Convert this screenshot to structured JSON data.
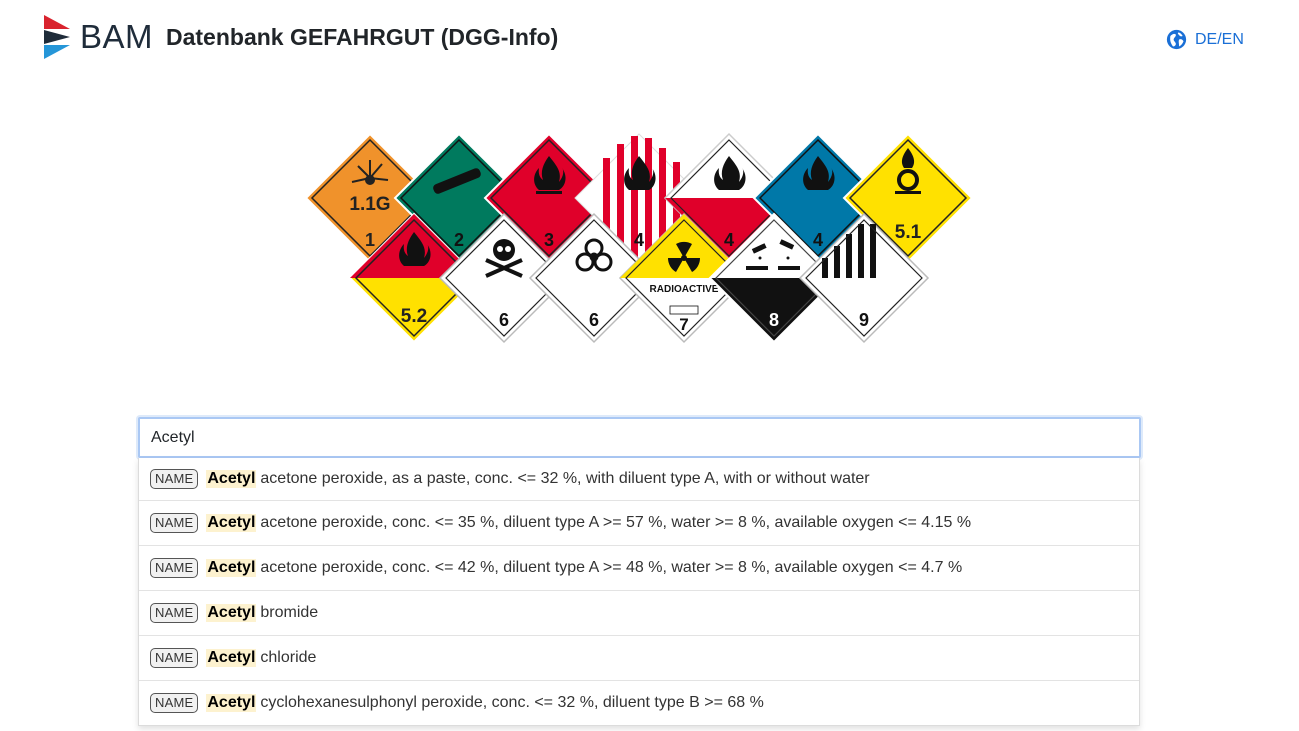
{
  "header": {
    "logo_text": "BAM",
    "title": "Datenbank GEFAHRGUT (DGG-Info)",
    "language_label": "DE/EN"
  },
  "hazard_labels": [
    {
      "text": "1.1G",
      "number": "1",
      "icon": "explosive-icon",
      "color": "#f0922b"
    },
    {
      "number": "2",
      "icon": "gas-cylinder-icon",
      "color": "#007a5e"
    },
    {
      "number": "3",
      "icon": "flame-icon",
      "color": "#e0002a"
    },
    {
      "number": "4",
      "icon": "flame-icon",
      "color": "#e0002a"
    },
    {
      "number": "4",
      "icon": "flame-icon",
      "color": "#e0002a"
    },
    {
      "number": "4",
      "icon": "flame-icon",
      "color": "#0078a8"
    },
    {
      "text": "5.1",
      "icon": "oxidizer-icon",
      "color": "#ffe100"
    },
    {
      "text": "5.2",
      "icon": "flame-icon",
      "color": "#e0002a"
    },
    {
      "number": "6",
      "icon": "skull-icon",
      "color": "#ffffff"
    },
    {
      "number": "6",
      "icon": "biohazard-icon",
      "color": "#ffffff"
    },
    {
      "text": "RADIOACTIVE",
      "number": "7",
      "icon": "radiation-icon",
      "color": "#ffe100"
    },
    {
      "number": "8",
      "icon": "corrosive-icon",
      "color": "#000000"
    },
    {
      "number": "9",
      "icon": "stripes-icon",
      "color": "#ffffff"
    }
  ],
  "search": {
    "value": "Acetyl",
    "highlight_color": "#fdf2cf",
    "focus_color": "#aac8f4"
  },
  "suggestions": [
    {
      "badge": "NAME",
      "match": "Acetyl",
      "rest": "acetone peroxide, as a paste, conc. <= 32 %, with diluent type A, with or without water"
    },
    {
      "badge": "NAME",
      "match": "Acetyl",
      "rest": "acetone peroxide, conc. <= 35 %, diluent type A >= 57 %, water >= 8 %, available oxygen <= 4.15 %"
    },
    {
      "badge": "NAME",
      "match": "Acetyl",
      "rest": "acetone peroxide, conc. <= 42 %, diluent type A >= 48 %, water >= 8 %, available oxygen <= 4.7 %"
    },
    {
      "badge": "NAME",
      "match": "Acetyl",
      "rest": "bromide"
    },
    {
      "badge": "NAME",
      "match": "Acetyl",
      "rest": "chloride"
    },
    {
      "badge": "NAME",
      "match": "Acetyl",
      "rest": "cyclohexanesulphonyl peroxide, conc. <= 32 %, diluent type B >= 68 %"
    }
  ]
}
